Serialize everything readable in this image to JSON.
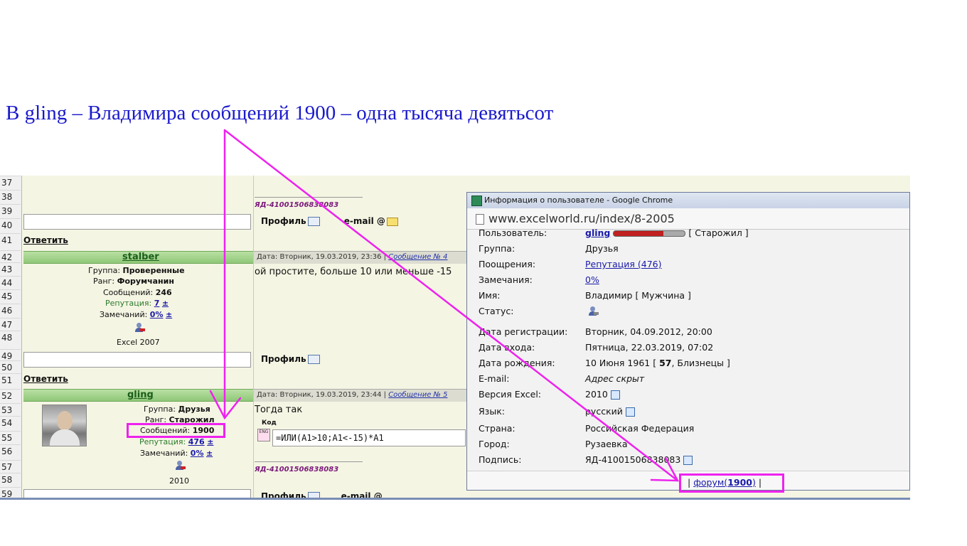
{
  "headline": "В gling – Владимира сообщений 1900 – одна тысяча девятьсот",
  "row_numbers": [
    "37",
    "38",
    "39",
    "40",
    "41",
    "42",
    "43",
    "44",
    "45",
    "46",
    "47",
    "48",
    "49",
    "50",
    "51",
    "52",
    "53",
    "54",
    "55",
    "56",
    "57",
    "58",
    "59"
  ],
  "sig_top": "ЯД-41001506838083",
  "profile_label": "Профиль",
  "email_label": "e-mail",
  "email_at": "@",
  "reply_label": "Ответить",
  "post1": {
    "user": "stalber",
    "date": "Дата: Вторник, 19.03.2019, 23:3",
    "date_tail": "6",
    "msg_link": "Сообщение № 4",
    "group_label": "Группа:",
    "group": "Проверенные",
    "rank_label": "Ранг:",
    "rank": "Форумчанин",
    "posts_label": "Сообщений:",
    "posts": "246",
    "rep_label": "Репутация:",
    "rep": "7",
    "rep_pm": "±",
    "warn_label": "Замечаний:",
    "warn": "0%",
    "warn_pm": "±",
    "version": "Excel 2007",
    "message": "ой простите, больше 10 или меньше -15"
  },
  "post2": {
    "user": "gling",
    "date": "Дата: Вторник, 19.03.2019, 23:44",
    "msg_link": "Сообщение № 5",
    "group_label": "Группа:",
    "group": "Друзья",
    "rank_label": "Ранг:",
    "rank": "Старожил",
    "posts_label": "Сообщений:",
    "posts": "1900",
    "rep_label": "Репутация:",
    "rep": "476",
    "rep_pm": "±",
    "warn_label": "Замечаний:",
    "warn": "0%",
    "warn_pm": "±",
    "version": "2010",
    "message": "Тогда так",
    "code_label": "Код",
    "code": "=ИЛИ(A1>10;A1<-15)*A1",
    "sig": "ЯД-41001506838083"
  },
  "popup": {
    "title": "Информация о пользователе - Google Chrome",
    "url": "www.excelworld.ru/index/8-2005",
    "rows": [
      {
        "label": "Пользователь:",
        "value": "gling",
        "extra": "[ Старожил ]"
      },
      {
        "label": "Группа:",
        "value": "Друзья"
      },
      {
        "label": "Поощрения:",
        "value": "Репутация (476)"
      },
      {
        "label": "Замечания:",
        "value": "0%"
      },
      {
        "label": "Имя:",
        "value": "Владимир [ Мужчина ]"
      },
      {
        "label": "Статус:",
        "value": ""
      },
      {
        "label": "Дата регистрации:",
        "value": "Вторник, 04.09.2012, 20:00"
      },
      {
        "label": "Дата входа:",
        "value": "Пятница, 22.03.2019, 07:02"
      },
      {
        "label": "Дата рождения:",
        "value": "10 Июня 1961 [",
        "bold": "57",
        "tail": ", Близнецы ]"
      },
      {
        "label": "E-mail:",
        "value": "Адрес скрыт"
      },
      {
        "label": "Версия Excel:",
        "value": "2010"
      },
      {
        "label": "Язык:",
        "value": "русский"
      },
      {
        "label": "Страна:",
        "value": "Российская Федерация"
      },
      {
        "label": "Город:",
        "value": "Рузаевка"
      },
      {
        "label": "Подпись:",
        "value": "ЯД-41001506838083"
      }
    ],
    "footer_pipe": "|",
    "footer_link": "форум(",
    "footer_count": "1900",
    "footer_close": ")"
  },
  "colors": {
    "annotation": "#ee22ee",
    "headline": "#1a1acc",
    "user_bar": "#a6d48f"
  }
}
